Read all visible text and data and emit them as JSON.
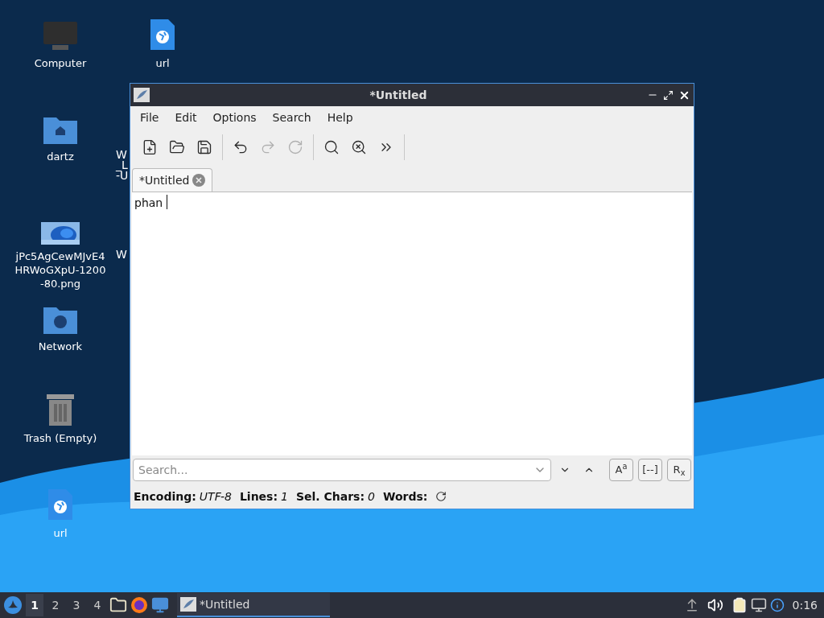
{
  "desktop_icons": [
    {
      "kind": "computer",
      "label": "Computer"
    },
    {
      "kind": "url",
      "label": "url"
    },
    {
      "kind": "home",
      "label": "dartz"
    },
    {
      "label": "jPc5AgCewMJvE4HRWoGXpU-1200-80.png"
    },
    {
      "kind": "network",
      "label": "Network"
    },
    {
      "kind": "trash",
      "label": "Trash (Empty)"
    },
    {
      "kind": "url",
      "label": "url"
    }
  ],
  "hidden_labels": [
    {
      "lines": [
        "W",
        "_L",
        "-U"
      ]
    },
    {
      "lines": [
        "W"
      ]
    }
  ],
  "window": {
    "title": "*Untitled",
    "menu": [
      "File",
      "Edit",
      "Options",
      "Search",
      "Help"
    ],
    "toolbar": [
      {
        "kind": "new",
        "disabled": false
      },
      {
        "kind": "open",
        "disabled": false
      },
      {
        "kind": "save",
        "disabled": false
      },
      {
        "kind": "sep"
      },
      {
        "kind": "undo",
        "disabled": false
      },
      {
        "kind": "redo",
        "disabled": true
      },
      {
        "kind": "reload",
        "disabled": true
      },
      {
        "kind": "sep"
      },
      {
        "kind": "find",
        "disabled": false
      },
      {
        "kind": "replace",
        "disabled": false
      },
      {
        "kind": "more",
        "disabled": false
      },
      {
        "kind": "sep"
      }
    ],
    "tabs": [
      {
        "label": "*Untitled",
        "selected": true
      }
    ],
    "text": "phan ",
    "search": {
      "placeholder": "Search...",
      "toggles": [
        "A$^{a}$",
        "[--]",
        "R$_{x}$"
      ]
    },
    "status": [
      {
        "label": "Encoding:",
        "value": "UTF-8"
      },
      {
        "label": "Lines:",
        "value": "1"
      },
      {
        "label": "Sel. Chars:",
        "value": "0"
      },
      {
        "label": "Words:"
      }
    ]
  },
  "taskbar": {
    "workspaces": [
      {
        "label": "1",
        "selected": true
      },
      {
        "label": "2",
        "selected": false
      },
      {
        "label": "3",
        "selected": false
      },
      {
        "label": "4",
        "selected": false
      }
    ],
    "tasks": [
      {
        "label": "*Untitled",
        "selected": true
      }
    ],
    "clock": "0:16"
  }
}
